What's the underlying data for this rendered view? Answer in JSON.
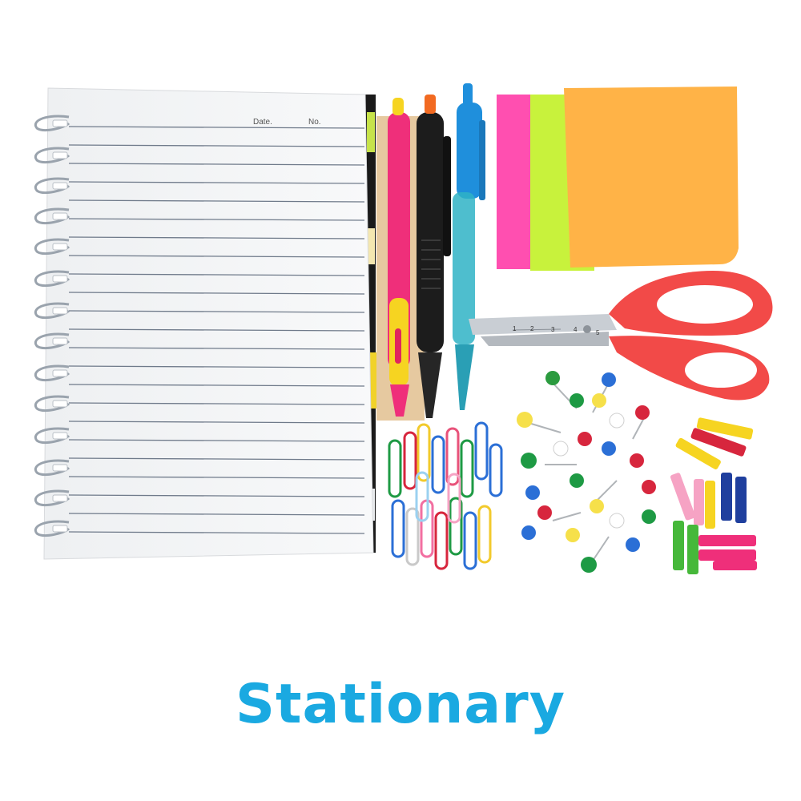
{
  "caption": "Stationary",
  "notebook": {
    "date_label": "Date.",
    "no_label": "No."
  },
  "ruler_marks": [
    "1",
    "2",
    "3",
    "4",
    "5"
  ],
  "colors": {
    "caption": "#1aa9e1",
    "sticky_pink": "#ff4fb0",
    "sticky_green": "#c8f23c",
    "sticky_orange": "#ffb347",
    "scissors_handle": "#f24a48",
    "pen_pink": "#ef2f7a",
    "pen_black": "#1c1c1c",
    "pen_blue": "#1f8fdc"
  }
}
